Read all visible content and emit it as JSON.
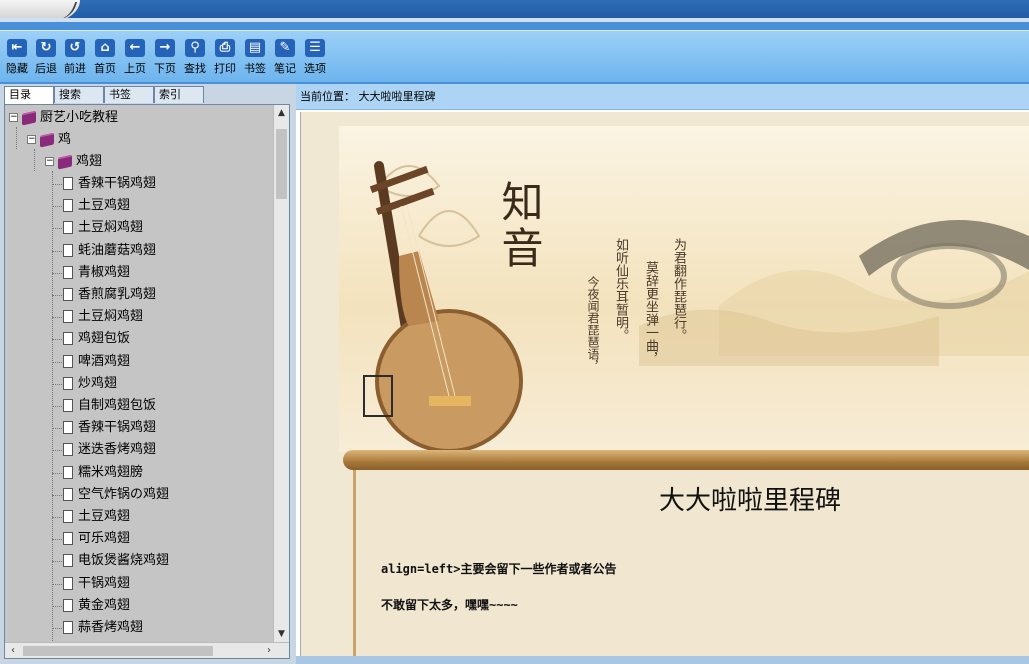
{
  "toolbar": {
    "items": [
      {
        "label": "隐藏",
        "icon": "hide-icon"
      },
      {
        "label": "后退",
        "icon": "back-icon"
      },
      {
        "label": "前进",
        "icon": "forward-icon"
      },
      {
        "label": "首页",
        "icon": "home-icon"
      },
      {
        "label": "上页",
        "icon": "prev-page-icon"
      },
      {
        "label": "下页",
        "icon": "next-page-icon"
      },
      {
        "label": "查找",
        "icon": "find-icon"
      },
      {
        "label": "打印",
        "icon": "print-icon"
      },
      {
        "label": "书签",
        "icon": "bookmark-icon"
      },
      {
        "label": "笔记",
        "icon": "note-icon"
      },
      {
        "label": "选项",
        "icon": "options-icon"
      }
    ]
  },
  "left": {
    "tabs": [
      "目录",
      "搜索",
      "书签",
      "索引"
    ],
    "tree": {
      "root": "厨艺小吃教程",
      "level1": "鸡",
      "level2": "鸡翅",
      "items": [
        "香辣干锅鸡翅",
        "土豆鸡翅",
        "土豆焖鸡翅",
        "蚝油蘑菇鸡翅",
        "青椒鸡翅",
        "香煎腐乳鸡翅",
        "土豆焖鸡翅",
        "鸡翅包饭",
        "啤酒鸡翅",
        "炒鸡翅",
        "自制鸡翅包饭",
        "香辣干锅鸡翅",
        "迷迭香烤鸡翅",
        "糯米鸡翅膀",
        "空气炸锅の鸡翅",
        "土豆鸡翅",
        "可乐鸡翅",
        "电饭煲酱烧鸡翅",
        "干锅鸡翅",
        "黄金鸡翅",
        "蒜香烤鸡翅"
      ]
    }
  },
  "right": {
    "breadcrumb": "当前位置： 大大啦啦里程碑",
    "banner": {
      "title": "知音",
      "poem_cols": [
        "为君翻作琵琶行。",
        "莫辞更坐弹一曲，",
        "如听仙乐耳暂明。",
        "今夜闻君琵琶语，"
      ]
    },
    "doc": {
      "title": "大大啦啦里程碑",
      "line1": "align=left>主要会留下一些作者或者公告",
      "line2": "不敢留下太多，嘿嘿~~~~"
    }
  },
  "colors": {
    "toolbar": "#8cc6f4",
    "titlebar": "#2a65b0",
    "tree_bg": "#c5c5c5",
    "book_icon": "#8a2a7a"
  }
}
